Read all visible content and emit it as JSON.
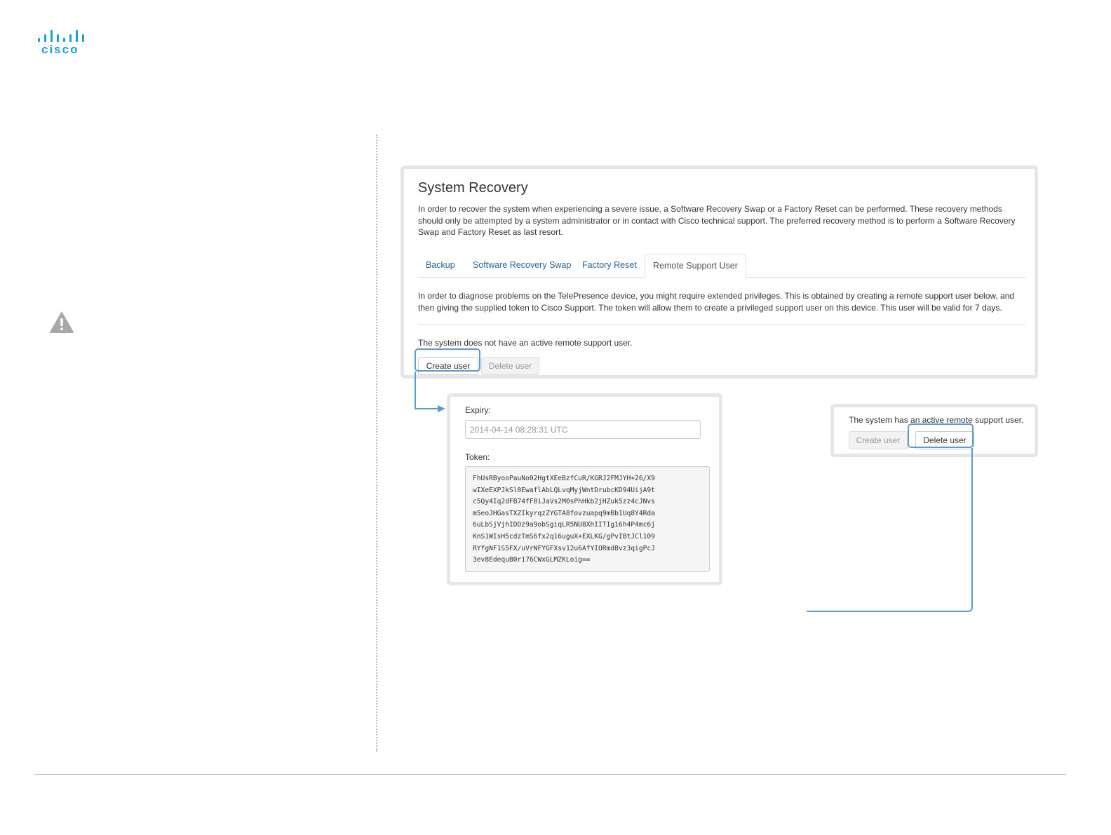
{
  "brand": {
    "logo_text": "cisco",
    "accent_color": "#1ba0d7"
  },
  "icons": {
    "warning": "warning-icon"
  },
  "system_recovery": {
    "title": "System Recovery",
    "intro": "In order to recover the system when experiencing a severe issue, a Software Recovery Swap or a Factory Reset can be performed. These recovery methods should only be attempted by a system administrator or in contact with Cisco technical support. The preferred recovery method is to perform a Software Recovery Swap and Factory Reset as last resort.",
    "tabs": [
      {
        "label": "Backup",
        "active": false
      },
      {
        "label": "Software Recovery Swap",
        "active": false
      },
      {
        "label": "Factory Reset",
        "active": false
      },
      {
        "label": "Remote Support User",
        "active": true
      }
    ],
    "diagnose_text": "In order to diagnose problems on the TelePresence device, you might require extended privileges. This is obtained by creating a remote support user below, and then giving the supplied token to Cisco Support. The token will allow them to create a privileged support user on this device. This user will be valid for 7 days.",
    "status_text": "The system does not have an active remote support user.",
    "create_button": "Create user",
    "delete_button": "Delete user"
  },
  "expiry_panel": {
    "expiry_label": "Expiry:",
    "expiry_value": "2014-04-14 08:28:31 UTC",
    "token_label": "Token:",
    "token_lines": [
      "FhUsRByooPauNo02HgtXEeBzfCuR/KGRJ2FMJYH+26/X9",
      "wIXeEXPJkSl0EwaflAbLQLvqMyjWntDrubcKD94UijA9t",
      "c5Qy4Iq2dFB74fF8iJaVs2M0sPhHkb2jHZuk5zz4cJNvs",
      "m5eoJHGasTXZIkyrqzZYGTA8fovzuapq9mBb1Uq8Y4Rda",
      "6uLbSjVjhIDDz9a9obSgiqLR5NU8XhIITIg16h4P4mc6j",
      "KnS1WIsH5cdzTmS6fx2q16uguX+EXLKG/gPvIBtJCl109",
      "RYfgNF1S5FX/uVrNFYGFXsv12u6AfYIORmd8vz3qigPcJ",
      "3ev8EdequB0r176CWxGLMZKLoig=="
    ]
  },
  "active_panel": {
    "status_text": "The system has an active remote support user.",
    "create_button": "Create user",
    "delete_button": "Delete user"
  }
}
